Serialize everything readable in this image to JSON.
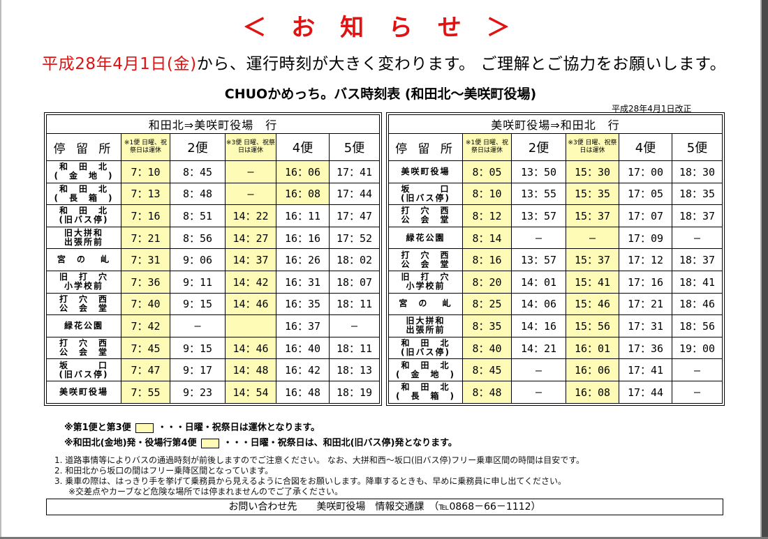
{
  "notice_title": "＜ お 知 ら せ ＞",
  "intro": {
    "red_part": "平成28年4月1日(金)",
    "black_part": "から、運行時刻が大きく変わります。 ご理解とご協力をお願いします。"
  },
  "table_title": "CHUOかめっち。バス時刻表 (和田北～美咲町役場)",
  "revision_note": "平成28年4月1日改正",
  "header": {
    "stop_label": "停 留 所",
    "trip1_note": "※1便 日曜、祝祭日は運休",
    "trip2": "2便",
    "trip3_note": "※3便 日曜、祝祭日は運休",
    "trip4": "4便",
    "trip5": "5便"
  },
  "left_table": {
    "direction": "和田北⇒美咲町役場　行",
    "rows": [
      {
        "stop": "和　田　北\n(　金　地　)",
        "t": [
          "7：10",
          "8：45",
          "―",
          "16：06",
          "17：41"
        ]
      },
      {
        "stop": "和　田　北\n(　長　箱　)",
        "t": [
          "7：13",
          "8：48",
          "―",
          "16：08",
          "17：44"
        ]
      },
      {
        "stop": "和　田　北\n(旧バス停)",
        "t": [
          "7：16",
          "8：51",
          "14：22",
          "16：11",
          "17：47"
        ]
      },
      {
        "stop": "旧大拼和\n出張所前",
        "t": [
          "7：21",
          "8：56",
          "14：27",
          "16：16",
          "17：52"
        ]
      },
      {
        "stop": "宮　の　 乢",
        "t": [
          "7：31",
          "9：06",
          "14：37",
          "16：26",
          "18：02"
        ]
      },
      {
        "stop": "旧　打　穴\n小学校前",
        "t": [
          "7：36",
          "9：11",
          "14：42",
          "16：31",
          "18：07"
        ]
      },
      {
        "stop": "打　穴　西\n公　会　堂",
        "t": [
          "7：40",
          "9：15",
          "14：46",
          "16：35",
          "18：11"
        ]
      },
      {
        "stop": "緑花公園",
        "t": [
          "7：42",
          "―",
          "",
          "16：37",
          "―"
        ]
      },
      {
        "stop": "打　穴　西\n公　会　堂",
        "t": [
          "7：45",
          "9：15",
          "14：46",
          "16：40",
          "18：11"
        ]
      },
      {
        "stop": "坂　　　口\n(旧バス停)",
        "t": [
          "7：47",
          "9：17",
          "14：48",
          "16：42",
          "18：13"
        ]
      },
      {
        "stop": "美咲町役場",
        "t": [
          "7：55",
          "9：23",
          "14：54",
          "16：48",
          "18：19"
        ]
      }
    ]
  },
  "right_table": {
    "direction": "美咲町役場⇒和田北　行",
    "rows": [
      {
        "stop": "美咲町役場",
        "t": [
          "8：05",
          "13：50",
          "15：30",
          "17：00",
          "18：30"
        ]
      },
      {
        "stop": "坂　　　口\n(旧バス停)",
        "t": [
          "8：10",
          "13：55",
          "15：35",
          "17：05",
          "18：35"
        ]
      },
      {
        "stop": "打　穴　西\n公　会　堂",
        "t": [
          "8：12",
          "13：57",
          "15：37",
          "17：07",
          "18：37"
        ]
      },
      {
        "stop": "緑花公園",
        "t": [
          "8：14",
          "―",
          "―",
          "17：09",
          "―"
        ]
      },
      {
        "stop": "打　穴　西\n公　会　堂",
        "t": [
          "8：16",
          "13：57",
          "15：37",
          "17：12",
          "18：37"
        ]
      },
      {
        "stop": "旧　打　穴\n小学校前",
        "t": [
          "8：20",
          "14：01",
          "15：41",
          "17：16",
          "18：41"
        ]
      },
      {
        "stop": "宮　の　 乢",
        "t": [
          "8：25",
          "14：06",
          "15：46",
          "17：21",
          "18：46"
        ]
      },
      {
        "stop": "旧大拼和\n出張所前",
        "t": [
          "8：35",
          "14：16",
          "15：56",
          "17：31",
          "18：56"
        ]
      },
      {
        "stop": "和　田　北\n(旧バス停)",
        "t": [
          "8：40",
          "14：21",
          "16：01",
          "17：36",
          "19：00"
        ]
      },
      {
        "stop": "和　田　北\n(　金　地　)",
        "t": [
          "8：45",
          "―",
          "16：06",
          "17：41",
          "―"
        ]
      },
      {
        "stop": "和　田　北\n(　長　箱　)",
        "t": [
          "8：48",
          "―",
          "16：08",
          "17：44",
          "―"
        ]
      }
    ]
  },
  "legend": {
    "line1_prefix": "※第1便と第3便",
    "line1_suffix": "・・・日曜・祝祭日は運休となります。",
    "line2_prefix": "※和田北(金地)発・役場行第4便",
    "line2_suffix": "・・・日曜・祝祭日は、和田北(旧バス停)発となります。"
  },
  "notes": [
    "1. 道路事情等によりバスの通過時刻が前後しますのでご注意ください。 なお、大拼和西～坂口(旧バス停)フリー乗車区間の時間は目安です。",
    "2. 和田北から坂口の間はフリー乗降区間となっています。",
    "3. 乗車の際は、はっきり手を挙げて乗務員から見えるように合図をお願いします。降車するときも、早めに乗務員に申し出てください。",
    "※交差点やカーブなど危険な場所では停まれませんのでご了承ください。"
  ],
  "contact": "お問い合わせ先　　美咲町役場　情報交通課　（℡0868－66－1112）",
  "colors": {
    "highlight": "#fdfbb6",
    "notice_red": "#e01212"
  }
}
